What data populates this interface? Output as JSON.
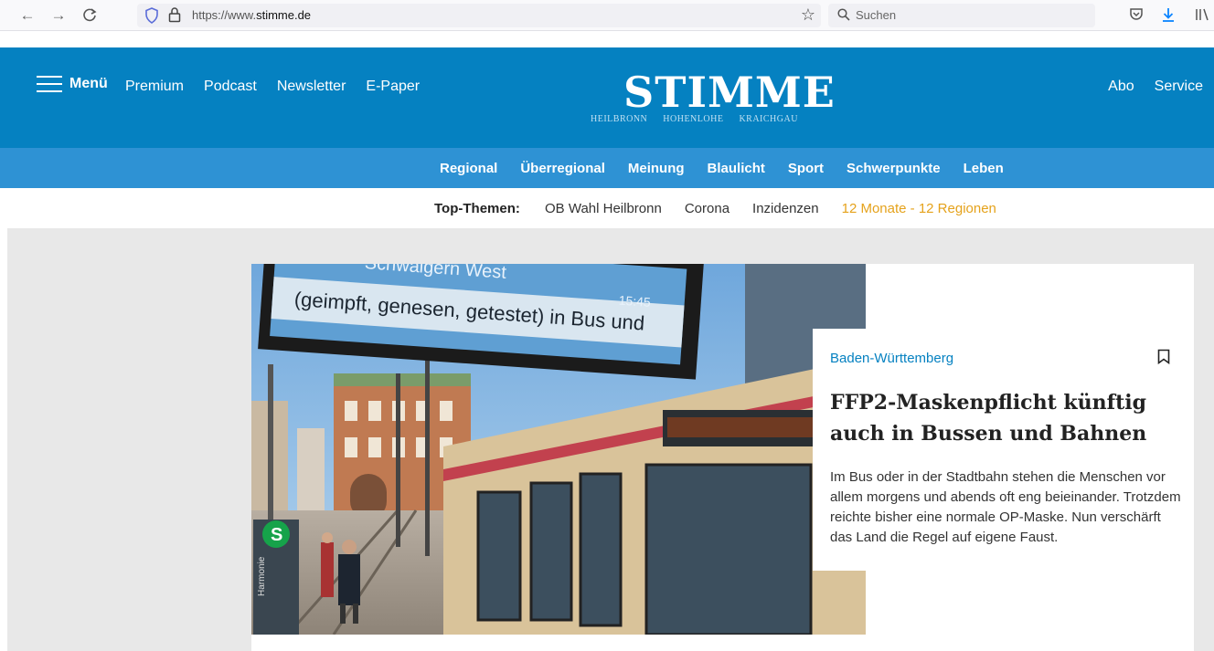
{
  "browser": {
    "url_prefix": "https://www.",
    "url_domain": "stimme.de",
    "search_placeholder": "Suchen"
  },
  "header": {
    "menu_label": "Menü",
    "top_links": [
      "Premium",
      "Podcast",
      "Newsletter",
      "E-Paper"
    ],
    "logo": "STIMME",
    "logo_regions": [
      "HEILBRONN",
      "HOHENLOHE",
      "KRAICHGAU"
    ],
    "right_links": [
      "Abo",
      "Service"
    ]
  },
  "categories": [
    "Regional",
    "Überregional",
    "Meinung",
    "Blaulicht",
    "Sport",
    "Schwerpunkte",
    "Leben"
  ],
  "top_themen": {
    "label": "Top-Themen:",
    "links": [
      "OB Wahl Heilbronn",
      "Corona",
      "Inzidenzen",
      "12 Monate - 12 Regionen"
    ]
  },
  "article": {
    "kicker": "Baden-Württemberg",
    "headline": "FFP2-Maskenpflicht künftig auch in Bussen und Bahnen",
    "teaser": "Im Bus oder in der Stadtbahn stehen die Menschen vor allem morgens und abends oft eng beieinander. Trotzdem reichte bisher eine normale OP-Maske. Nun verschärft das Land die Regel auf eigene Faust.",
    "image_text": {
      "sign_line1": "Schwaigern West",
      "sign_line2": "(geimpft, genesen, getestet) in Bus und",
      "sign_time": "15:45",
      "harmonie": "Harmonie"
    }
  },
  "colors": {
    "brand_blue": "#0581c1",
    "nav_blue": "#2e92d4",
    "highlight": "#e5a21b"
  }
}
